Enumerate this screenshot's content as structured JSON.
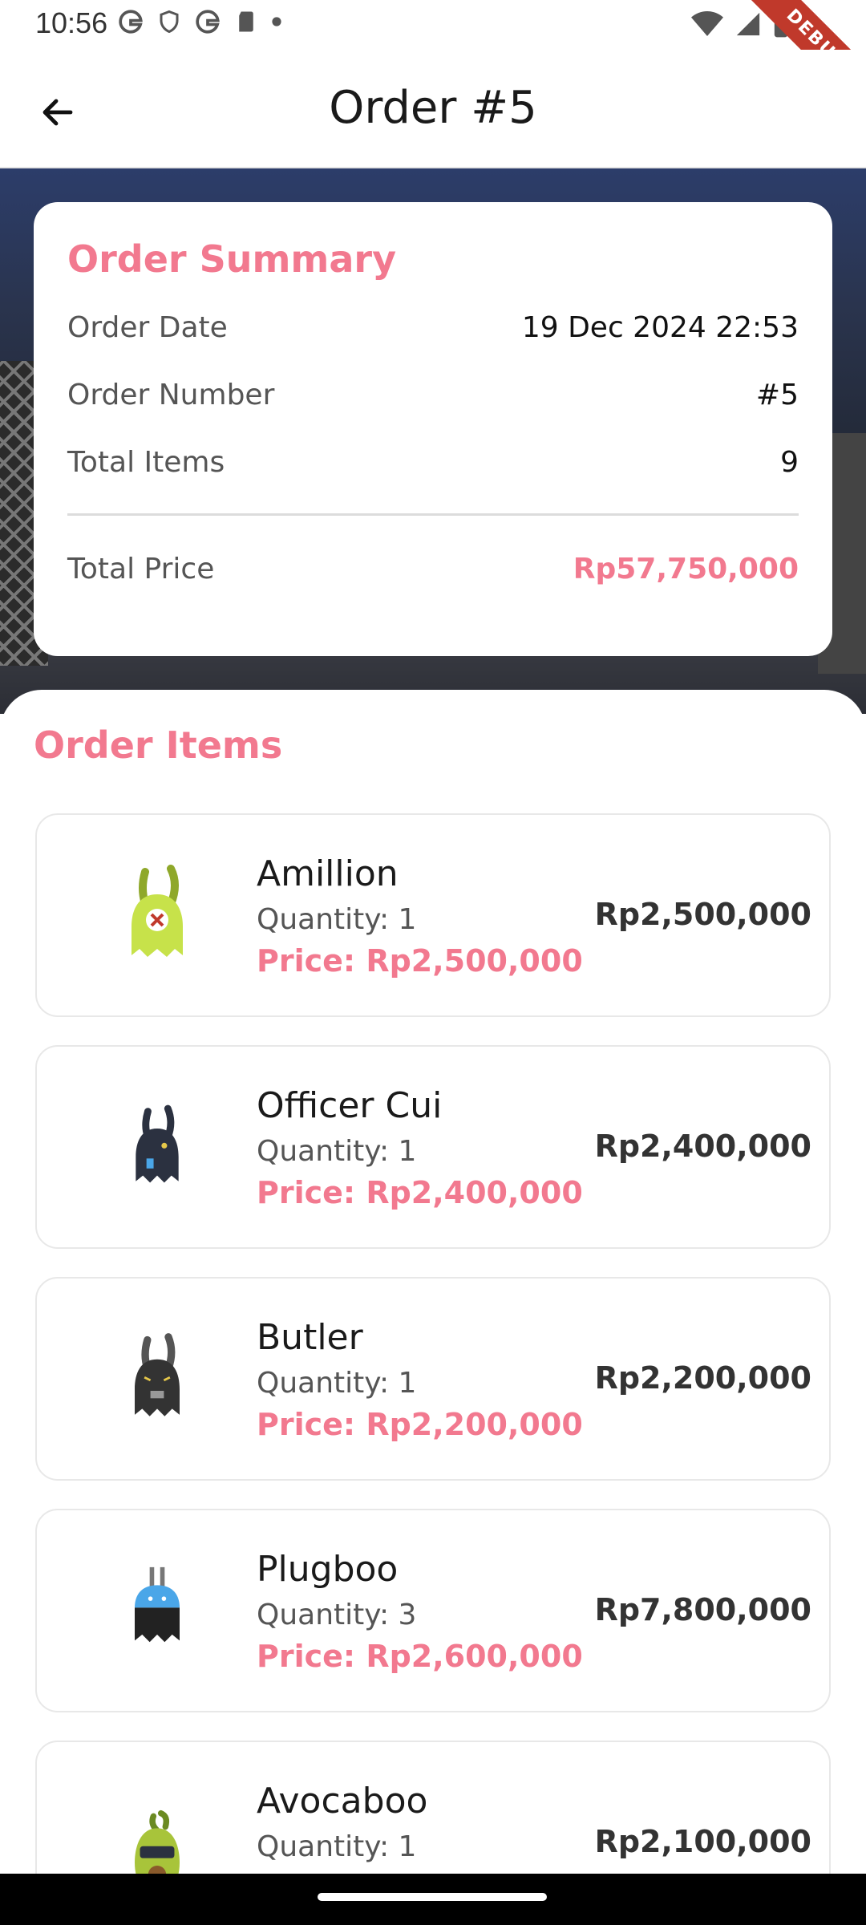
{
  "status_bar": {
    "time": "10:56",
    "debug_label": "DEBUG"
  },
  "app_bar": {
    "title": "Order #5"
  },
  "summary": {
    "title": "Order Summary",
    "rows": [
      {
        "label": "Order Date",
        "value": "19 Dec 2024 22:53"
      },
      {
        "label": "Order Number",
        "value": "#5"
      },
      {
        "label": "Total Items",
        "value": "9"
      }
    ],
    "total_label": "Total Price",
    "total_value": "Rp57,750,000"
  },
  "items": {
    "title": "Order Items",
    "list": [
      {
        "name": "Amillion",
        "quantity": "Quantity: 1",
        "price": "Price: Rp2,500,000",
        "total": "Rp2,500,000",
        "color": "#c7e24a"
      },
      {
        "name": "Officer Cui",
        "quantity": "Quantity: 1",
        "price": "Price: Rp2,400,000",
        "total": "Rp2,400,000",
        "color": "#2b3140"
      },
      {
        "name": "Butler",
        "quantity": "Quantity: 1",
        "price": "Price: Rp2,200,000",
        "total": "Rp2,200,000",
        "color": "#333333"
      },
      {
        "name": "Plugboo",
        "quantity": "Quantity: 3",
        "price": "Price: Rp2,600,000",
        "total": "Rp7,800,000",
        "color": "#4aa6e8"
      },
      {
        "name": "Avocaboo",
        "quantity": "Quantity: 1",
        "price": "",
        "total": "Rp2,100,000",
        "color": "#a8c43a"
      }
    ]
  },
  "colors": {
    "accent": "#f2798f"
  }
}
